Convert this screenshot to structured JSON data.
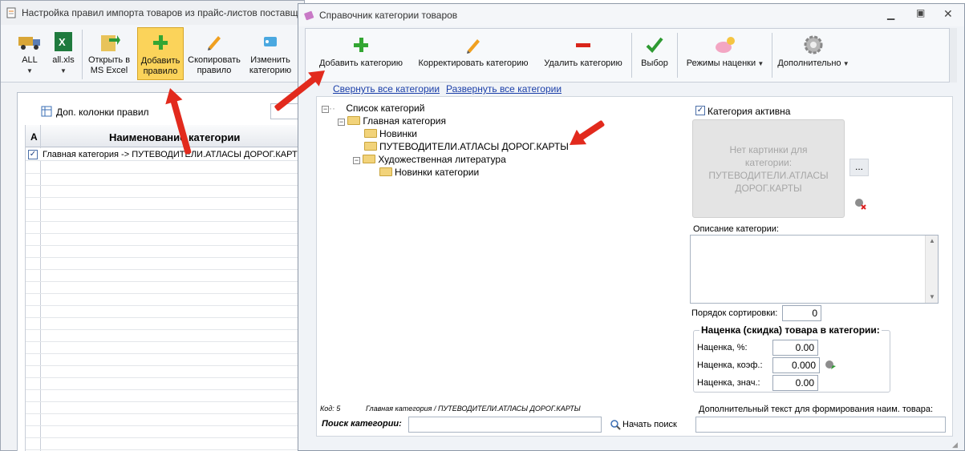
{
  "back_window": {
    "title": "Настройка правил импорта товаров из прайс-листов поставщ",
    "toolbar": {
      "all": "ALL",
      "allxls": "all.xls",
      "open_excel_1": "Открыть в",
      "open_excel_2": "MS Excel",
      "add_rule_1": "Добавить",
      "add_rule_2": "правило",
      "copy_rule_1": "Скопировать",
      "copy_rule_2": "правило",
      "change_cat_1": "Изменить",
      "change_cat_2": "категорию"
    },
    "extra_columns": "Доп. колонки правил",
    "grid": {
      "col_a": "А",
      "col_name": "Наименование категории",
      "row1": "Главная категория -> ПУТЕВОДИТЕЛИ.АТЛАСЫ ДОРОГ.КАРТЫ"
    }
  },
  "front_window": {
    "title": "Справочник категории товаров",
    "toolbar": {
      "add": "Добавить категорию",
      "edit": "Корректировать категорию",
      "delete": "Удалить категорию",
      "select": "Выбор",
      "markup": "Режимы наценки",
      "extra": "Дополнительно"
    },
    "links": {
      "collapse": "Свернуть все категории",
      "expand": "Развернуть все категории"
    },
    "tree": {
      "root": "Список категорий",
      "main": "Главная категория",
      "new": "Новинки",
      "guides": "ПУТЕВОДИТЕЛИ.АТЛАСЫ ДОРОГ.КАРТЫ",
      "fiction": "Художественная литература",
      "new_cat": "Новинки категории"
    },
    "details": {
      "active": "Категория активна",
      "no_image": "Нет картинки для категории: ПУТЕВОДИТЕЛИ.АТЛАСЫ ДОРОГ.КАРТЫ",
      "browse": "...",
      "description": "Описание категории:",
      "sort_order": "Порядок сортировки:",
      "sort_value": "0",
      "markup_group": "Наценка (скидка) товара в категории:",
      "markup_pct": "Наценка, %:",
      "markup_pct_value": "0.00",
      "markup_coef": "Наценка, коэф.:",
      "markup_coef_value": "0.000",
      "markup_val": "Наценка, знач.:",
      "markup_val_value": "0.00",
      "extra_text": "Дополнительный текст для формирования наим. товара:"
    },
    "footer": {
      "code": "Код: 5",
      "path": "Главная категория / ПУТЕВОДИТЕЛИ.АТЛАСЫ ДОРОГ.КАРТЫ",
      "search_label": "Поиск категории:",
      "search_button": "Начать поиск"
    }
  },
  "colors": {
    "accent": "#e22a1d",
    "link": "#1a3ea8",
    "highlight": "#fbd35a"
  }
}
